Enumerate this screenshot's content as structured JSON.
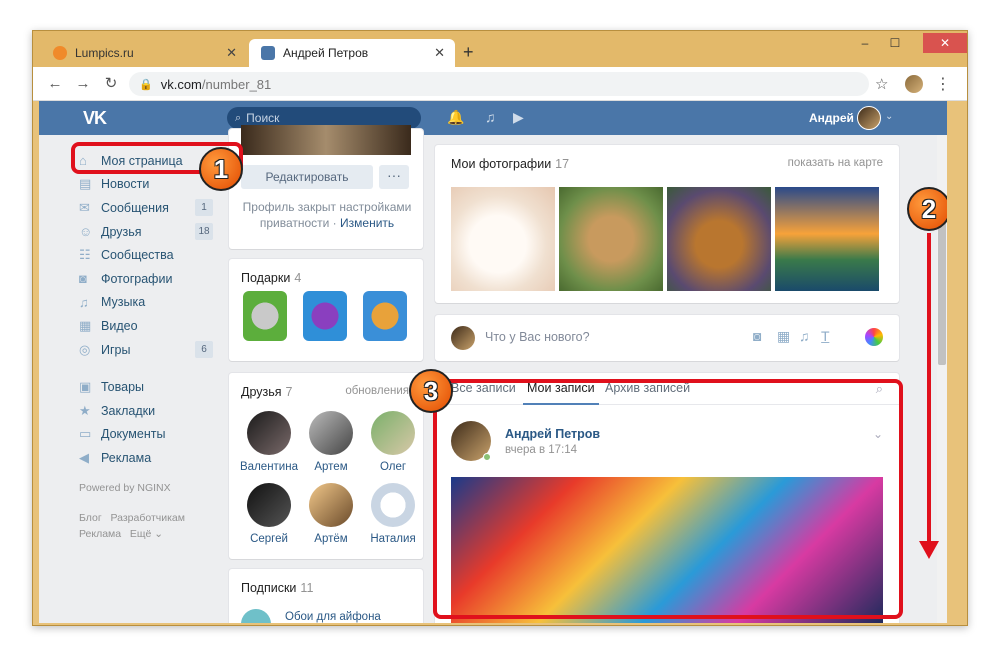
{
  "browser": {
    "tabs": [
      {
        "title": "Lumpics.ru",
        "active": false
      },
      {
        "title": "Андрей Петров",
        "active": true
      }
    ],
    "new_tab": "+",
    "url_host": "vk.com",
    "url_path": "/number_81",
    "controls": {
      "minimize": "–",
      "maximize": "☐",
      "close": "✕"
    }
  },
  "vk": {
    "logo": "VK",
    "search_placeholder": "Поиск",
    "user_name": "Андрей",
    "nav": [
      {
        "label": "Моя страница",
        "icon": "home-icon",
        "count": ""
      },
      {
        "label": "Новости",
        "icon": "news-icon",
        "count": ""
      },
      {
        "label": "Сообщения",
        "icon": "messages-icon",
        "count": "1"
      },
      {
        "label": "Друзья",
        "icon": "friends-icon",
        "count": "18"
      },
      {
        "label": "Сообщества",
        "icon": "groups-icon",
        "count": ""
      },
      {
        "label": "Фотографии",
        "icon": "camera-icon",
        "count": ""
      },
      {
        "label": "Музыка",
        "icon": "music-icon",
        "count": ""
      },
      {
        "label": "Видео",
        "icon": "video-icon",
        "count": ""
      },
      {
        "label": "Игры",
        "icon": "games-icon",
        "count": "6"
      }
    ],
    "nav2": [
      {
        "label": "Товары",
        "icon": "bag-icon"
      },
      {
        "label": "Закладки",
        "icon": "star-icon"
      },
      {
        "label": "Документы",
        "icon": "document-icon"
      },
      {
        "label": "Реклама",
        "icon": "megaphone-icon"
      }
    ],
    "powered": "Powered by NGINX",
    "footer_links": [
      "Блог",
      "Разработчикам",
      "Реклама",
      "Ещё ⌄"
    ],
    "profile": {
      "edit_label": "Редактировать",
      "more_label": "···",
      "privacy_text": "Профиль закрыт настройками приватности ·",
      "privacy_link": "Изменить"
    },
    "gifts": {
      "title": "Подарки",
      "count": "4"
    },
    "friends": {
      "title": "Друзья",
      "count": "7",
      "updates": "обновления",
      "list": [
        "Валентина",
        "Артем",
        "Олег",
        "Сергей",
        "Артём",
        "Наталия"
      ]
    },
    "subscriptions": {
      "title": "Подписки",
      "count": "11",
      "first": "Обои для айфона"
    },
    "photos": {
      "title": "Мои фотографии",
      "count": "17",
      "map_link": "показать на карте"
    },
    "composer": {
      "placeholder": "Что у Вас нового?"
    },
    "wall": {
      "tabs": [
        "Все записи",
        "Мои записи",
        "Архив записей"
      ],
      "active_tab": 1,
      "post_author": "Андрей Петров",
      "post_time": "вчера в 17:14"
    }
  },
  "annotations": [
    "1",
    "2",
    "3"
  ],
  "colors": {
    "vk_blue": "#4a76a8",
    "annotation_red": "#e0101c",
    "tab_bar": "#e3b96a"
  }
}
